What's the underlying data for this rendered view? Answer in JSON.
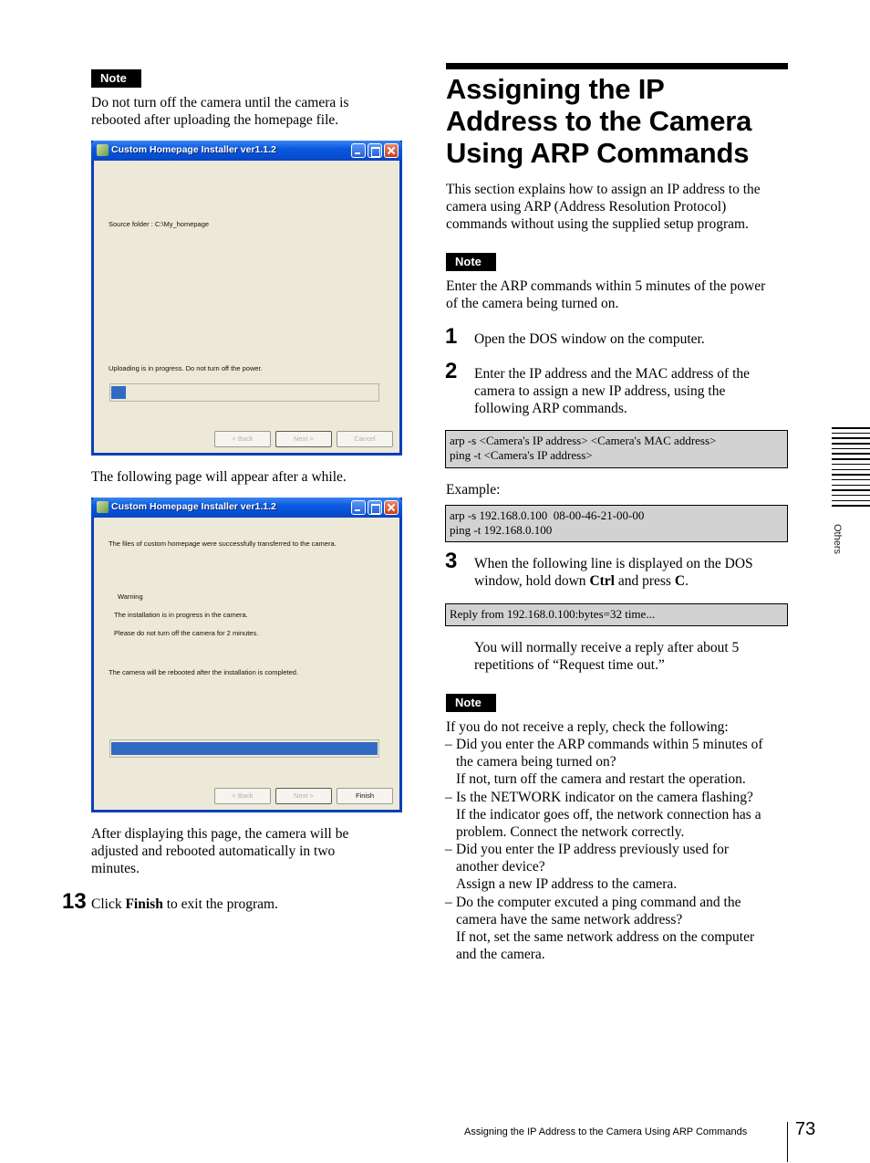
{
  "left_column": {
    "note1": {
      "badge": "Note",
      "text_line1": "Do not turn off the camera until the camera is",
      "text_line2": "rebooted after uploading the homepage file."
    },
    "window1": {
      "title": "Custom Homepage Installer ver1.1.2",
      "source_folder": "Source folder : C:\\My_homepage",
      "status": "Uploading is in progress. Do not turn off the power.",
      "progress_percent": 6,
      "buttons": {
        "back": "< Back",
        "next": "Next >",
        "cancel": "Cancel"
      }
    },
    "between_text": "The following page will appear after a while.",
    "window2": {
      "title": "Custom Homepage Installer ver1.1.2",
      "line1": "The files of custom homepage were successfully transferred to the camera.",
      "warning": "Warning",
      "line2": "The installation is in progress in the camera.",
      "line3": "Please do not turn off the camera for 2 minutes.",
      "line4": "The camera will be rebooted after the installation is completed.",
      "progress_percent": 100,
      "buttons": {
        "back": "< Back",
        "next": "Next >",
        "finish": "Finish"
      }
    },
    "after_text_line1": "After displaying this page, the camera will be",
    "after_text_line2": "adjusted and rebooted automatically in two",
    "after_text_line3": "minutes.",
    "step13": {
      "number": "13",
      "pre": "Click ",
      "bold": "Finish",
      "post": " to exit the program."
    }
  },
  "right_column": {
    "heading_line1": "Assigning the IP",
    "heading_line2": "Address to the Camera",
    "heading_line3": "Using ARP Commands",
    "intro_line1": "This section explains how to assign an IP address to the",
    "intro_line2": "camera using ARP (Address Resolution Protocol)",
    "intro_line3": "commands without using the supplied setup program.",
    "note2": {
      "badge": "Note",
      "line1": "Enter the ARP commands within 5 minutes of the power",
      "line2": "of the camera being turned on."
    },
    "step1": {
      "number": "1",
      "text": "Open the DOS window on the computer."
    },
    "step2": {
      "number": "2",
      "line1": "Enter the IP address and the MAC address of the",
      "line2": "camera to assign a new IP address, using the",
      "line3": "following ARP commands."
    },
    "code1": {
      "line1": "arp -s <Camera's IP address> <Camera's MAC address>",
      "line2": "ping -t <Camera's IP address>"
    },
    "example_label": "Example:",
    "code2": {
      "line1": "arp -s 192.168.0.100  08-00-46-21-00-00",
      "line2": "ping -t 192.168.0.100"
    },
    "step3": {
      "number": "3",
      "line1": "When the following line is displayed on the DOS",
      "line2_pre": "window, hold down ",
      "line2_bold1": "Ctrl",
      "line2_mid": " and press ",
      "line2_bold2": "C",
      "line2_post": "."
    },
    "code3": {
      "line1": "Reply from 192.168.0.100:bytes=32 time..."
    },
    "reply_line1": "You will normally receive a reply after about 5",
    "reply_line2": "repetitions of “Request time out.”",
    "note3": {
      "badge": "Note",
      "intro": "If you do not receive a reply, check the following:",
      "items": [
        {
          "dash": "–",
          "lines": [
            "Did you enter the ARP commands within 5 minutes of",
            "the camera being turned on?",
            "If not, turn off the camera and restart the operation."
          ]
        },
        {
          "dash": "–",
          "lines": [
            "Is the NETWORK indicator on the camera flashing?",
            "If the indicator goes off, the network connection has a",
            "problem.  Connect the network correctly."
          ]
        },
        {
          "dash": "–",
          "lines": [
            "Did you enter the IP address previously used for",
            "another device?",
            "Assign a new IP address to the camera."
          ]
        },
        {
          "dash": "–",
          "lines": [
            "Do the computer excuted a ping command and the",
            "camera have the same network address?",
            "If not, set the same network address on the computer",
            "and the camera."
          ]
        }
      ]
    }
  },
  "side_tab": {
    "label": "Others"
  },
  "footer": {
    "section_title": "Assigning the IP Address to the Camera Using ARP Commands",
    "page_number": "73"
  }
}
